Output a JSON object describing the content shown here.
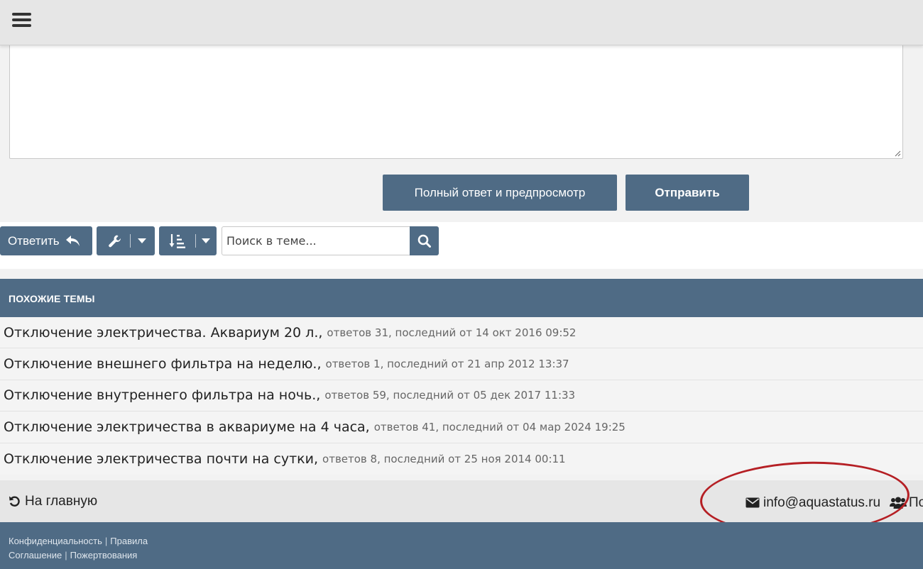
{
  "editor": {
    "preview_label": "Полный ответ и предпросмотр",
    "send_label": "Отправить"
  },
  "toolbar": {
    "reply_label": "Ответить",
    "search_placeholder": "Поиск в теме..."
  },
  "similar": {
    "header": "ПОХОЖИЕ ТЕМЫ",
    "topics": [
      {
        "title": "Отключение электричества. Аквариум 20 л.,",
        "meta": "ответов 31, последний от 14 окт 2016 09:52"
      },
      {
        "title": "Отключение внешнего фильтра на неделю.,",
        "meta": "ответов 1, последний от 21 апр 2012 13:37"
      },
      {
        "title": "Отключение внутреннего фильтра на ночь.,",
        "meta": "ответов 59, последний от 05 дек 2017 11:33"
      },
      {
        "title": "Отключение электричества в аквариуме на 4 часа,",
        "meta": "ответов 41, последний от 04 мар 2024 19:25"
      },
      {
        "title": "Отключение электричества почти на сутки,",
        "meta": "ответов 8, последний от 25 ноя 2014 00:11"
      }
    ]
  },
  "footer": {
    "home_label": "На главную",
    "email": "info@aquastatus.ru",
    "users_label": "По",
    "links": {
      "privacy": "Конфиденциальность",
      "rules": "Правила",
      "agreement": "Соглашение",
      "donations": "Пожертвования"
    }
  },
  "colors": {
    "accent": "#4f6b85",
    "annotation": "#b51f24"
  }
}
